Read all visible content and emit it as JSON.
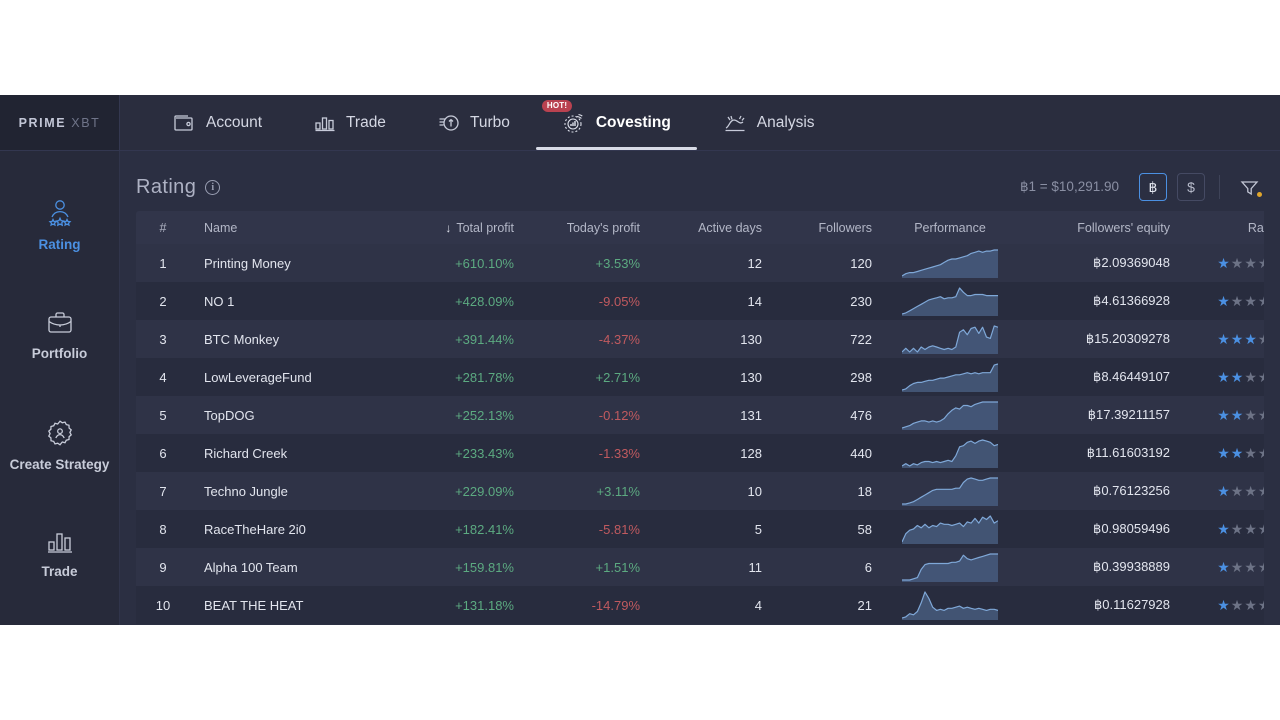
{
  "brand": {
    "name_primary": "PRIME",
    "name_secondary": "XBT"
  },
  "topnav": {
    "items": [
      {
        "label": "Account",
        "icon": "wallet-icon",
        "active": false,
        "badge": ""
      },
      {
        "label": "Trade",
        "icon": "bar-chart-icon",
        "active": false,
        "badge": ""
      },
      {
        "label": "Turbo",
        "icon": "turbo-icon",
        "active": false,
        "badge": ""
      },
      {
        "label": "Covesting",
        "icon": "covesting-icon",
        "active": true,
        "badge": "HOT!"
      },
      {
        "label": "Analysis",
        "icon": "analysis-icon",
        "active": false,
        "badge": ""
      }
    ]
  },
  "sidebar": {
    "items": [
      {
        "label": "Rating",
        "icon": "user-stars-icon",
        "active": true
      },
      {
        "label": "Portfolio",
        "icon": "briefcase-icon",
        "active": false
      },
      {
        "label": "Create Strategy",
        "icon": "gear-user-icon",
        "active": false
      },
      {
        "label": "Trade",
        "icon": "bar-chart-icon",
        "active": false
      }
    ]
  },
  "page": {
    "title": "Rating",
    "info_icon": "i",
    "rate_text": "฿1 = $10,291.90",
    "currency_buttons": [
      {
        "label": "฿",
        "active": true
      },
      {
        "label": "$",
        "active": false
      }
    ],
    "filter_icon": "filter-icon"
  },
  "table": {
    "columns": [
      {
        "key": "rank",
        "label": "#",
        "sorted": false
      },
      {
        "key": "name",
        "label": "Name",
        "sorted": false
      },
      {
        "key": "total",
        "label": "Total profit",
        "sorted": true,
        "sort_dir": "↓"
      },
      {
        "key": "today",
        "label": "Today's profit",
        "sorted": false
      },
      {
        "key": "days",
        "label": "Active days",
        "sorted": false
      },
      {
        "key": "foll",
        "label": "Followers",
        "sorted": false
      },
      {
        "key": "perf",
        "label": "Performance",
        "sorted": false
      },
      {
        "key": "eq",
        "label": "Followers' equity",
        "sorted": false
      },
      {
        "key": "rate",
        "label": "Rating",
        "sorted": false
      }
    ],
    "rows": [
      {
        "rank": "1",
        "name": "Printing Money",
        "total": "+610.10%",
        "total_sign": "pos",
        "today": "+3.53%",
        "today_sign": "pos",
        "days": "12",
        "foll": "120",
        "eq": "฿2.09369048",
        "stars": 1,
        "spark": [
          26,
          24,
          23,
          23,
          22,
          21,
          20,
          19,
          18,
          17,
          16,
          14,
          12,
          11,
          11,
          10,
          9,
          8,
          6,
          5,
          4,
          5,
          4,
          4,
          3,
          3
        ]
      },
      {
        "rank": "2",
        "name": "NO 1",
        "total": "+428.09%",
        "total_sign": "pos",
        "today": "-9.05%",
        "today_sign": "neg",
        "days": "14",
        "foll": "230",
        "eq": "฿4.61366928",
        "stars": 1,
        "spark": [
          28,
          27,
          25,
          23,
          21,
          19,
          17,
          15,
          14,
          13,
          12,
          14,
          13,
          13,
          12,
          4,
          8,
          11,
          11,
          10,
          10,
          10,
          11,
          11,
          11,
          11
        ]
      },
      {
        "rank": "3",
        "name": "BTC Monkey",
        "total": "+391.44%",
        "total_sign": "pos",
        "today": "-4.37%",
        "today_sign": "neg",
        "days": "130",
        "foll": "722",
        "eq": "฿15.20309278",
        "stars": 3,
        "spark": [
          24,
          21,
          24,
          21,
          24,
          20,
          22,
          20,
          19,
          20,
          21,
          22,
          21,
          22,
          20,
          8,
          6,
          10,
          5,
          4,
          9,
          4,
          12,
          13,
          3,
          4
        ]
      },
      {
        "rank": "4",
        "name": "LowLeverageFund",
        "total": "+281.78%",
        "total_sign": "pos",
        "today": "+2.71%",
        "today_sign": "pos",
        "days": "130",
        "foll": "298",
        "eq": "฿8.46449107",
        "stars": 2,
        "spark": [
          27,
          26,
          23,
          21,
          20,
          20,
          19,
          18,
          18,
          17,
          16,
          16,
          15,
          14,
          13,
          13,
          12,
          11,
          12,
          11,
          12,
          11,
          11,
          11,
          4,
          3
        ]
      },
      {
        "rank": "5",
        "name": "TopDOG",
        "total": "+252.13%",
        "total_sign": "pos",
        "today": "-0.12%",
        "today_sign": "neg",
        "days": "131",
        "foll": "476",
        "eq": "฿17.39211157",
        "stars": 2,
        "spark": [
          27,
          26,
          25,
          23,
          22,
          21,
          21,
          22,
          21,
          22,
          21,
          19,
          15,
          12,
          10,
          11,
          8,
          8,
          9,
          7,
          6,
          5,
          5,
          5,
          5,
          5
        ]
      },
      {
        "rank": "6",
        "name": "Richard Creek",
        "total": "+233.43%",
        "total_sign": "pos",
        "today": "-1.33%",
        "today_sign": "neg",
        "days": "128",
        "foll": "440",
        "eq": "฿11.61603192",
        "stars": 2,
        "spark": [
          25,
          23,
          25,
          23,
          24,
          22,
          21,
          21,
          22,
          21,
          22,
          21,
          20,
          21,
          16,
          8,
          7,
          4,
          3,
          5,
          3,
          2,
          3,
          4,
          7,
          6
        ]
      },
      {
        "rank": "7",
        "name": "Techno Jungle",
        "total": "+229.09%",
        "total_sign": "pos",
        "today": "+3.11%",
        "today_sign": "pos",
        "days": "10",
        "foll": "18",
        "eq": "฿0.76123256",
        "stars": 1,
        "spark": [
          27,
          27,
          26,
          25,
          23,
          21,
          19,
          17,
          15,
          14,
          14,
          14,
          14,
          14,
          13,
          13,
          8,
          5,
          4,
          5,
          6,
          6,
          5,
          4,
          4,
          4
        ]
      },
      {
        "rank": "8",
        "name": "RaceTheHare 2i0",
        "total": "+182.41%",
        "total_sign": "pos",
        "today": "-5.81%",
        "today_sign": "neg",
        "days": "5",
        "foll": "58",
        "eq": "฿0.98059496",
        "stars": 1,
        "spark": [
          25,
          18,
          15,
          14,
          11,
          13,
          10,
          13,
          11,
          12,
          9,
          10,
          10,
          11,
          10,
          9,
          12,
          8,
          9,
          5,
          9,
          4,
          6,
          3,
          9,
          7
        ]
      },
      {
        "rank": "9",
        "name": "Alpha 100 Team",
        "total": "+159.81%",
        "total_sign": "pos",
        "today": "+1.51%",
        "today_sign": "pos",
        "days": "11",
        "foll": "6",
        "eq": "฿0.39938889",
        "stars": 1,
        "spark": [
          27,
          27,
          27,
          26,
          25,
          18,
          14,
          13,
          13,
          13,
          13,
          13,
          13,
          12,
          12,
          11,
          6,
          9,
          10,
          9,
          8,
          7,
          6,
          5,
          5,
          5
        ]
      },
      {
        "rank": "10",
        "name": "BEAT THE HEAT",
        "total": "+131.18%",
        "total_sign": "pos",
        "today": "-14.79%",
        "today_sign": "neg",
        "days": "4",
        "foll": "21",
        "eq": "฿0.11627928",
        "stars": 1,
        "spark": [
          26,
          25,
          22,
          23,
          20,
          12,
          2,
          8,
          16,
          19,
          18,
          19,
          17,
          17,
          16,
          15,
          17,
          16,
          17,
          18,
          17,
          18,
          19,
          18,
          18,
          19
        ]
      }
    ],
    "stars_total": 5
  },
  "colors": {
    "accent": "#4b90e2",
    "positive": "#5caa81",
    "negative": "#c05a5f",
    "badge": "#b94250",
    "filter_dot": "#e0a62c",
    "panel": "#2b2f42",
    "row_odd": "#2f3347",
    "row_even": "#282c3e"
  }
}
